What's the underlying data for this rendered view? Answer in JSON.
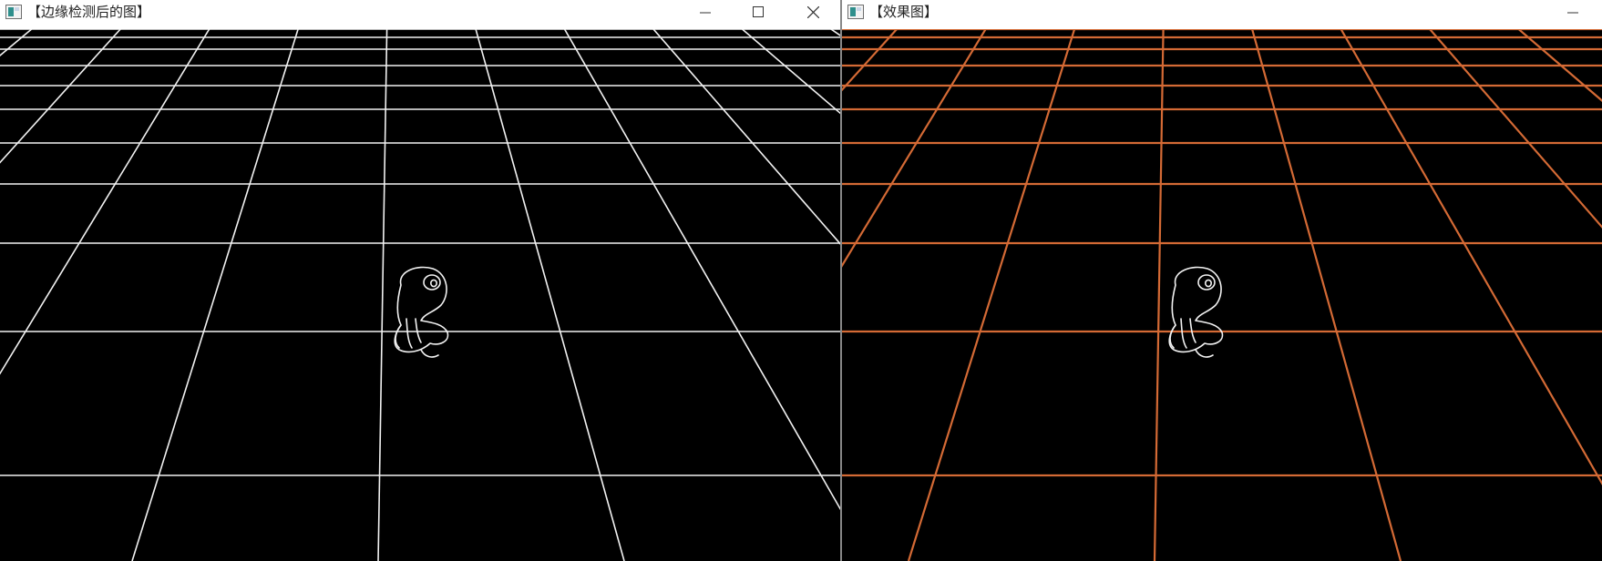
{
  "windows": [
    {
      "id": "left",
      "title": "【边缘检测后的图】",
      "controls": [
        "minimize",
        "maximize",
        "close"
      ],
      "content": "edge-detection-image",
      "line_color": "#f2f2f2"
    },
    {
      "id": "right",
      "title": "【效果图】",
      "controls": [
        "minimize"
      ],
      "content": "hough-lines-image",
      "line_color": "#d46a35"
    }
  ],
  "colors": {
    "canvas_background": "#000000",
    "titlebar_background": "#ffffff",
    "edge_lines": "#f2f2f2",
    "hough_lines": "#d46a35"
  }
}
